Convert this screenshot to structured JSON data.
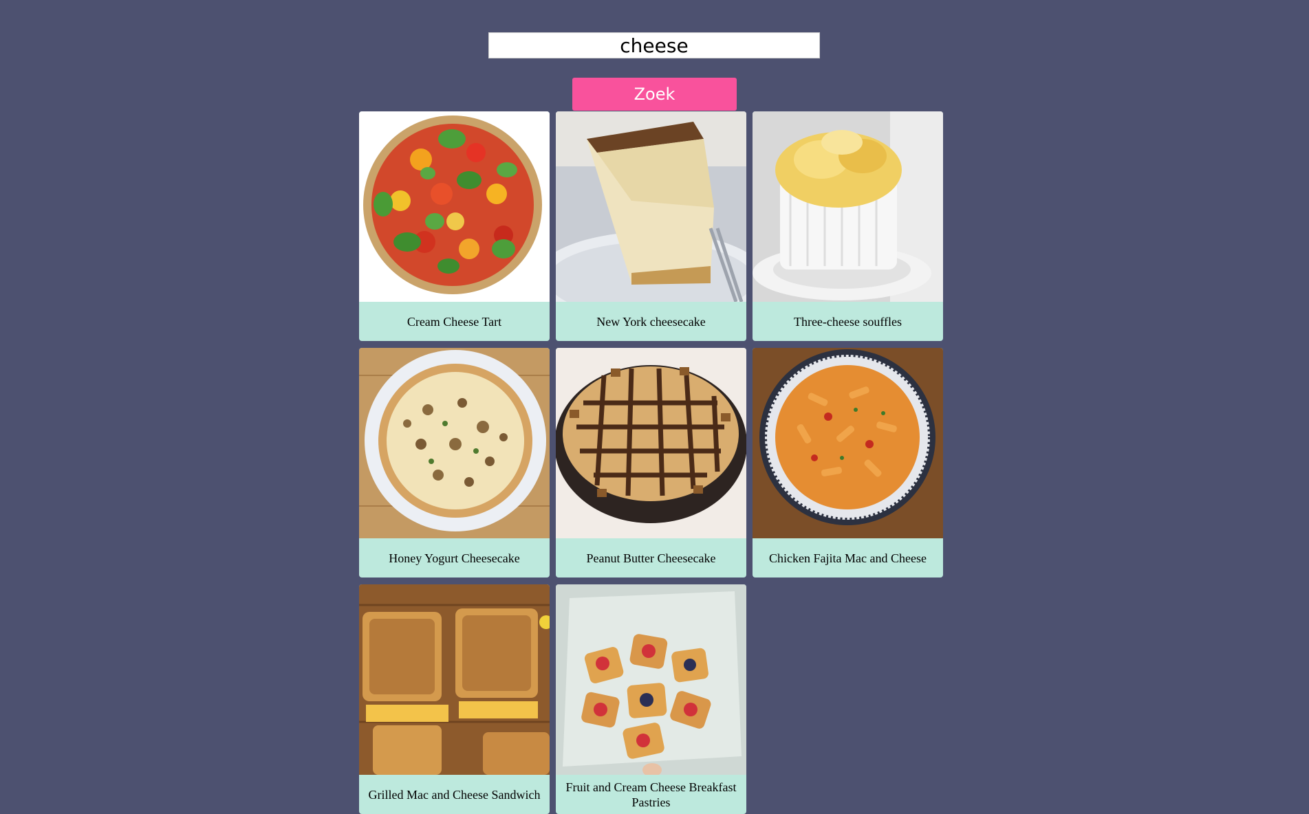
{
  "search": {
    "value": "cheese",
    "button_label": "Zoek"
  },
  "results": [
    {
      "title": "Cream Cheese Tart",
      "image": "tomato-tart"
    },
    {
      "title": "New York cheesecake",
      "image": "cheesecake-slice"
    },
    {
      "title": "Three-cheese souffles",
      "image": "souffle"
    },
    {
      "title": "Honey Yogurt Cheesecake",
      "image": "mushroom-tart"
    },
    {
      "title": "Peanut Butter Cheesecake",
      "image": "peanut-butter-pie"
    },
    {
      "title": "Chicken Fajita Mac and Cheese",
      "image": "pasta-bowl"
    },
    {
      "title": "Grilled Mac and Cheese Sandwich",
      "image": "grilled-sandwich"
    },
    {
      "title": "Fruit and Cream Cheese Breakfast Pastries",
      "image": "fruit-pastries"
    }
  ]
}
